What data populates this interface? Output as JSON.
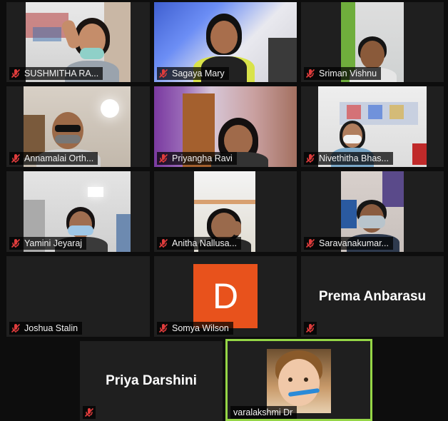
{
  "participants": [
    {
      "name": "SUSHMITHA RA...",
      "muted": true
    },
    {
      "name": "Sagaya Mary",
      "muted": true
    },
    {
      "name": "Sriman Vishnu",
      "muted": true
    },
    {
      "name": "Annamalai Orth...",
      "muted": true
    },
    {
      "name": "Priyangha Ravi",
      "muted": true
    },
    {
      "name": "Nivethitha Bhas...",
      "muted": true
    },
    {
      "name": "Yamini Jeyaraj",
      "muted": true
    },
    {
      "name": "Anitha Nallusa...",
      "muted": true
    },
    {
      "name": "Saravanakumar...",
      "muted": true
    },
    {
      "name": "Joshua Stalin",
      "muted": true
    },
    {
      "name": "Somya Wilson",
      "muted": true,
      "avatar_letter": "D",
      "avatar_color": "#e8521c"
    },
    {
      "name": "",
      "display_name": "Prema Anbarasu",
      "muted": true
    },
    {
      "name": "",
      "display_name": "Priya Darshini",
      "muted": true
    },
    {
      "name": "varalakshmi Dr",
      "muted": false,
      "active_speaker": true
    }
  ],
  "colors": {
    "active_border": "#95d646",
    "mute_icon": "#e03c3c",
    "tile_bg": "#1f1f1f"
  },
  "icons": {
    "mute": "microphone-muted-icon"
  }
}
